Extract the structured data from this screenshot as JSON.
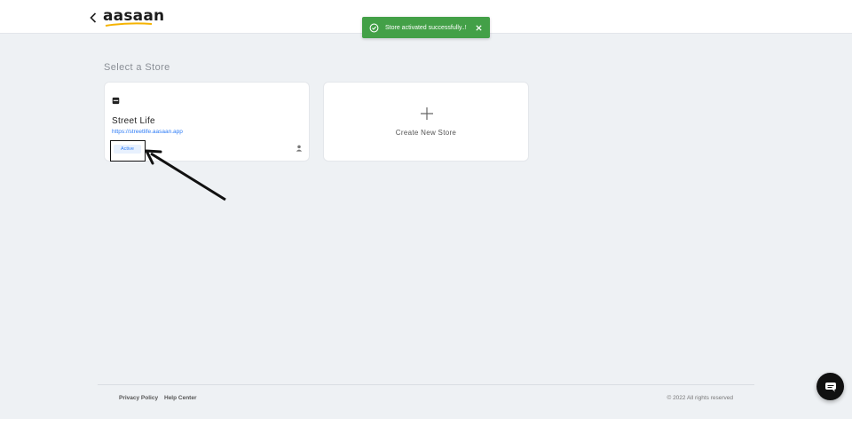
{
  "header": {
    "logo_text": "aasaan",
    "back_icon": "chevron-left-icon",
    "brand_color": "#f5b301"
  },
  "toast": {
    "message": "Store activated successfully..!",
    "icon": "check-circle-icon",
    "close_icon": "close-icon",
    "color": "#43a047"
  },
  "main": {
    "section_title": "Select a Store",
    "stores": [
      {
        "name": "Street Life",
        "url": "https://streetlife.aasaan.app",
        "status": "Active",
        "icon": "store-icon",
        "owner_icon": "user-icon"
      }
    ],
    "create_store": {
      "label": "Create New Store",
      "icon": "plus-icon"
    }
  },
  "footer": {
    "links": [
      "Privacy Policy",
      "Help Center"
    ],
    "copyright": "© 2022 All rights reserved"
  },
  "chat": {
    "icon": "chat-icon"
  }
}
